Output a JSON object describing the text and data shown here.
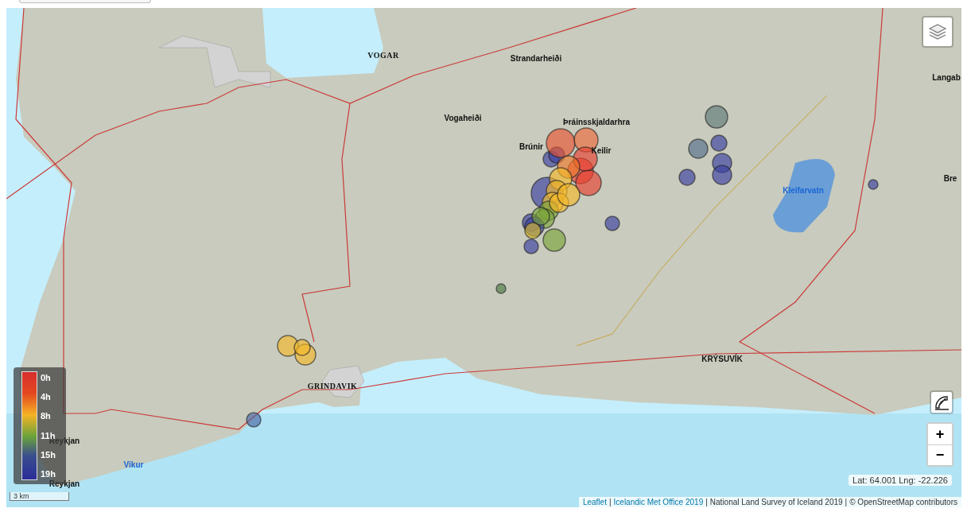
{
  "map": {
    "places": [
      {
        "name": "VOGAR",
        "kind": "town"
      },
      {
        "name": "Strandarheiði",
        "kind": "place"
      },
      {
        "name": "Vogaheiði",
        "kind": "place"
      },
      {
        "name": "Þráinsskjaldarhra",
        "kind": "place"
      },
      {
        "name": "Brúnir",
        "kind": "place"
      },
      {
        "name": "Keilir",
        "kind": "place"
      },
      {
        "name": "Kleifarvatn",
        "kind": "water"
      },
      {
        "name": "Langab",
        "kind": "place"
      },
      {
        "name": "Bre",
        "kind": "place"
      },
      {
        "name": "KRÝSUVÍK",
        "kind": "place"
      },
      {
        "name": "GRINDAVIK",
        "kind": "town"
      },
      {
        "name": "Reykjan",
        "kind": "place"
      },
      {
        "name": "Reykjan",
        "kind": "place"
      },
      {
        "name": "Vikur",
        "kind": "water"
      }
    ],
    "legend": {
      "labels": [
        "0h",
        "4h",
        "8h",
        "11h",
        "15h",
        "19h"
      ]
    },
    "scale": "3 km",
    "coordinates": "Lat: 64.001 Lng: -22.226",
    "attribution": [
      {
        "text": "Leaflet",
        "kind": "link"
      },
      {
        "text": "Icelandic Met Office 2019",
        "kind": "link"
      },
      {
        "text": "National Land Survey of Iceland 2019",
        "kind": "text"
      },
      {
        "text": "© OpenStreetMap contributors",
        "kind": "text"
      }
    ],
    "separator": "|",
    "zoom": {
      "in": "+",
      "out": "−"
    }
  }
}
